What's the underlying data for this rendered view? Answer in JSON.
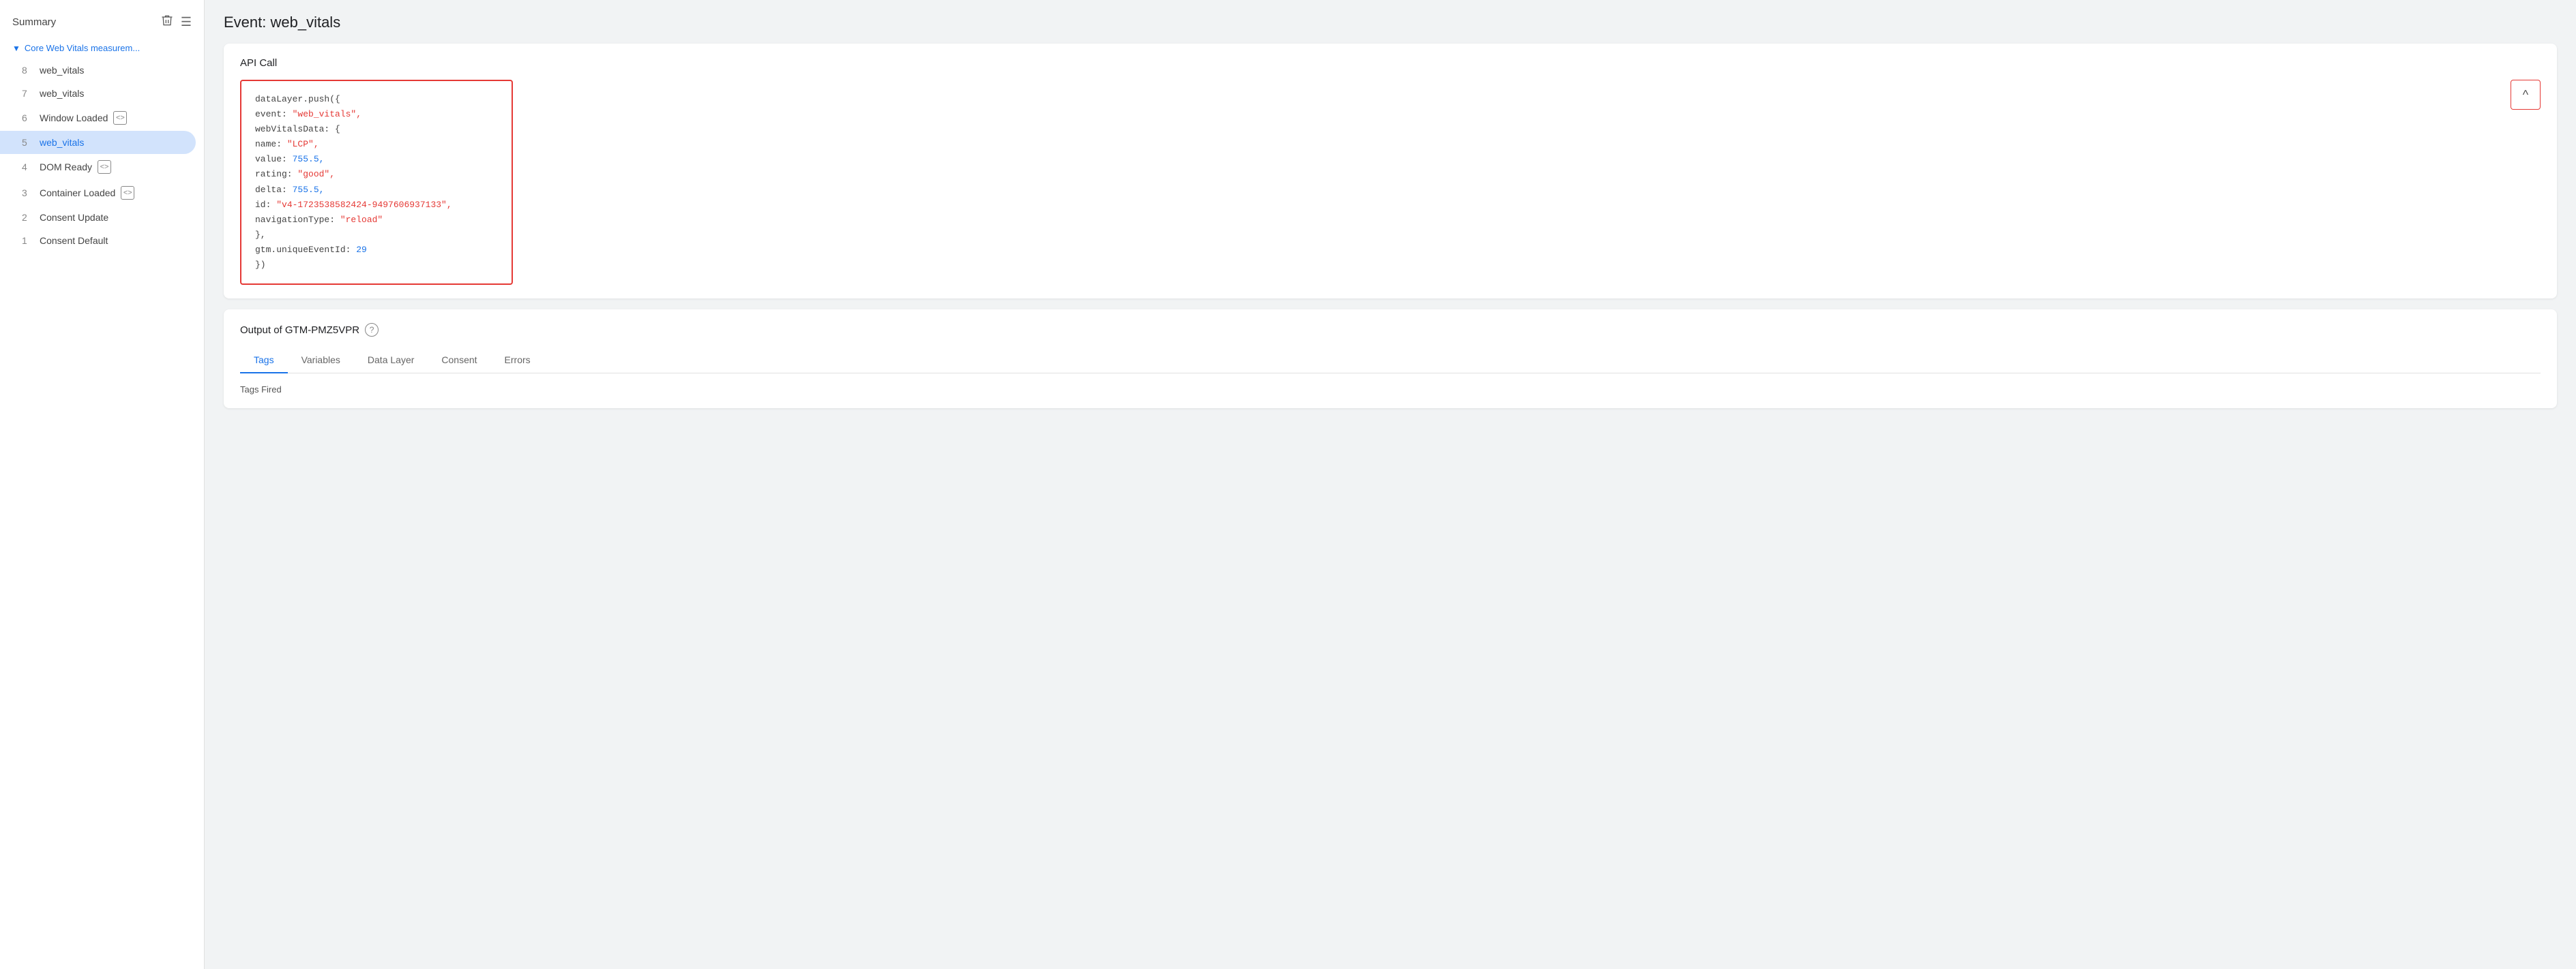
{
  "sidebar": {
    "summary_label": "Summary",
    "group_label": "Core Web Vitals measurem...",
    "items": [
      {
        "num": "8",
        "label": "web_vitals",
        "icon": false,
        "active": false
      },
      {
        "num": "7",
        "label": "web_vitals",
        "icon": false,
        "active": false
      },
      {
        "num": "6",
        "label": "Window Loaded",
        "icon": true,
        "active": false
      },
      {
        "num": "5",
        "label": "web_vitals",
        "icon": false,
        "active": true
      },
      {
        "num": "4",
        "label": "DOM Ready",
        "icon": true,
        "active": false
      },
      {
        "num": "3",
        "label": "Container Loaded",
        "icon": true,
        "active": false
      },
      {
        "num": "2",
        "label": "Consent Update",
        "icon": false,
        "active": false
      },
      {
        "num": "1",
        "label": "Consent Default",
        "icon": false,
        "active": false
      }
    ]
  },
  "main": {
    "page_title": "Event: web_vitals",
    "api_call": {
      "section_title": "API Call",
      "code_lines": [
        {
          "type": "plain",
          "text": "dataLayer.push({"
        },
        {
          "type": "key-str",
          "key": "  event: ",
          "value": "\"web_vitals\","
        },
        {
          "type": "plain",
          "text": "  webVitalsData: {"
        },
        {
          "type": "key-str",
          "key": "    name: ",
          "value": "\"LCP\","
        },
        {
          "type": "key-num",
          "key": "    value: ",
          "value": "755.5,"
        },
        {
          "type": "key-str",
          "key": "    rating: ",
          "value": "\"good\","
        },
        {
          "type": "key-num",
          "key": "    delta: ",
          "value": "755.5,"
        },
        {
          "type": "key-str",
          "key": "    id: ",
          "value": "\"v4-1723538582424-9497606937133\","
        },
        {
          "type": "key-str",
          "key": "    navigationType: ",
          "value": "\"reload\""
        },
        {
          "type": "plain",
          "text": "  },"
        },
        {
          "type": "key-num",
          "key": "  gtm.uniqueEventId: ",
          "value": "29"
        },
        {
          "type": "plain",
          "text": "})"
        }
      ],
      "collapse_icon": "^"
    },
    "output": {
      "section_title": "Output of GTM-PMZ5VPR",
      "tabs": [
        "Tags",
        "Variables",
        "Data Layer",
        "Consent",
        "Errors"
      ],
      "active_tab": "Tags",
      "tags_fired_label": "Tags Fired"
    }
  },
  "icons": {
    "trash": "🗑",
    "filter": "≡",
    "chevron_down": "▼",
    "code_brackets": "<>",
    "help": "?"
  }
}
